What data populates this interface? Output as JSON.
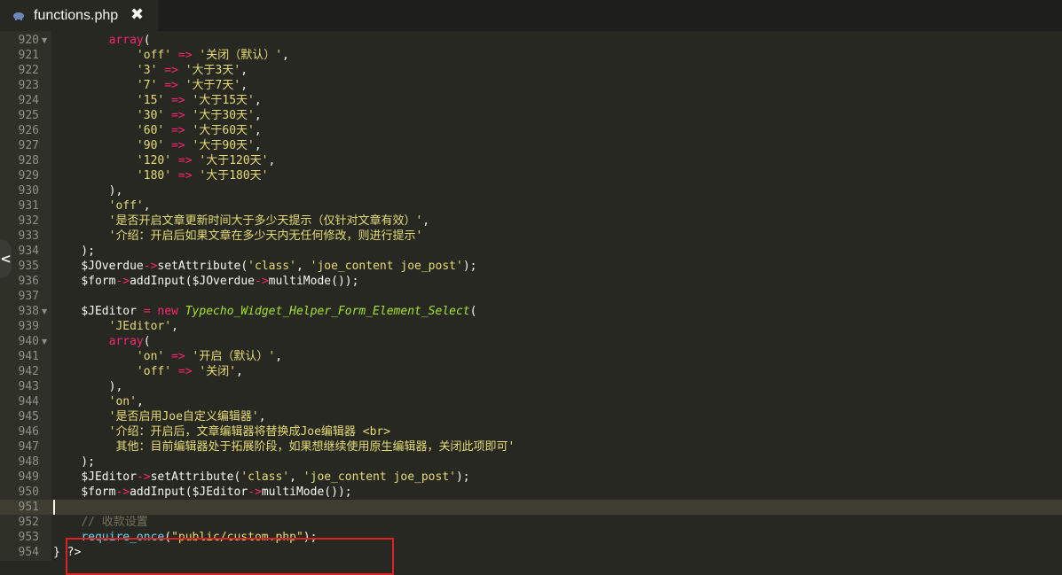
{
  "tab": {
    "filename": "functions.php",
    "close_glyph": "✖",
    "icon": "php-elephant-icon"
  },
  "side_toggle": {
    "glyph": "<"
  },
  "colors": {
    "background": "#272822",
    "gutter": "#2f3129",
    "string": "#e6db74",
    "keyword": "#f92672",
    "class": "#a6e22e",
    "comment": "#75715e",
    "highlight_box": "#e02020"
  },
  "lines": [
    {
      "n": "920",
      "fold": true,
      "tokens": [
        [
          "p",
          "        "
        ],
        [
          "k",
          "array"
        ],
        [
          "p",
          "("
        ]
      ]
    },
    {
      "n": "921",
      "fold": false,
      "tokens": [
        [
          "p",
          "            "
        ],
        [
          "s",
          "'off'"
        ],
        [
          "p",
          " "
        ],
        [
          "k",
          "=>"
        ],
        [
          "p",
          " "
        ],
        [
          "s",
          "'关闭（默认）'"
        ],
        [
          "p",
          ","
        ]
      ]
    },
    {
      "n": "922",
      "fold": false,
      "tokens": [
        [
          "p",
          "            "
        ],
        [
          "s",
          "'3'"
        ],
        [
          "p",
          " "
        ],
        [
          "k",
          "=>"
        ],
        [
          "p",
          " "
        ],
        [
          "s",
          "'大于3天'"
        ],
        [
          "p",
          ","
        ]
      ]
    },
    {
      "n": "923",
      "fold": false,
      "tokens": [
        [
          "p",
          "            "
        ],
        [
          "s",
          "'7'"
        ],
        [
          "p",
          " "
        ],
        [
          "k",
          "=>"
        ],
        [
          "p",
          " "
        ],
        [
          "s",
          "'大于7天'"
        ],
        [
          "p",
          ","
        ]
      ]
    },
    {
      "n": "924",
      "fold": false,
      "tokens": [
        [
          "p",
          "            "
        ],
        [
          "s",
          "'15'"
        ],
        [
          "p",
          " "
        ],
        [
          "k",
          "=>"
        ],
        [
          "p",
          " "
        ],
        [
          "s",
          "'大于15天'"
        ],
        [
          "p",
          ","
        ]
      ]
    },
    {
      "n": "925",
      "fold": false,
      "tokens": [
        [
          "p",
          "            "
        ],
        [
          "s",
          "'30'"
        ],
        [
          "p",
          " "
        ],
        [
          "k",
          "=>"
        ],
        [
          "p",
          " "
        ],
        [
          "s",
          "'大于30天'"
        ],
        [
          "p",
          ","
        ]
      ]
    },
    {
      "n": "926",
      "fold": false,
      "tokens": [
        [
          "p",
          "            "
        ],
        [
          "s",
          "'60'"
        ],
        [
          "p",
          " "
        ],
        [
          "k",
          "=>"
        ],
        [
          "p",
          " "
        ],
        [
          "s",
          "'大于60天'"
        ],
        [
          "p",
          ","
        ]
      ]
    },
    {
      "n": "927",
      "fold": false,
      "tokens": [
        [
          "p",
          "            "
        ],
        [
          "s",
          "'90'"
        ],
        [
          "p",
          " "
        ],
        [
          "k",
          "=>"
        ],
        [
          "p",
          " "
        ],
        [
          "s",
          "'大于90天'"
        ],
        [
          "p",
          ","
        ]
      ]
    },
    {
      "n": "928",
      "fold": false,
      "tokens": [
        [
          "p",
          "            "
        ],
        [
          "s",
          "'120'"
        ],
        [
          "p",
          " "
        ],
        [
          "k",
          "=>"
        ],
        [
          "p",
          " "
        ],
        [
          "s",
          "'大于120天'"
        ],
        [
          "p",
          ","
        ]
      ]
    },
    {
      "n": "929",
      "fold": false,
      "tokens": [
        [
          "p",
          "            "
        ],
        [
          "s",
          "'180'"
        ],
        [
          "p",
          " "
        ],
        [
          "k",
          "=>"
        ],
        [
          "p",
          " "
        ],
        [
          "s",
          "'大于180天'"
        ]
      ]
    },
    {
      "n": "930",
      "fold": false,
      "tokens": [
        [
          "p",
          "        ),"
        ]
      ]
    },
    {
      "n": "931",
      "fold": false,
      "tokens": [
        [
          "p",
          "        "
        ],
        [
          "s",
          "'off'"
        ],
        [
          "p",
          ","
        ]
      ]
    },
    {
      "n": "932",
      "fold": false,
      "tokens": [
        [
          "p",
          "        "
        ],
        [
          "s",
          "'是否开启文章更新时间大于多少天提示（仅针对文章有效）'"
        ],
        [
          "p",
          ","
        ]
      ]
    },
    {
      "n": "933",
      "fold": false,
      "tokens": [
        [
          "p",
          "        "
        ],
        [
          "s",
          "'介绍：开启后如果文章在多少天内无任何修改，则进行提示'"
        ]
      ]
    },
    {
      "n": "934",
      "fold": false,
      "tokens": [
        [
          "p",
          "    );"
        ]
      ]
    },
    {
      "n": "935",
      "fold": false,
      "tokens": [
        [
          "p",
          "    "
        ],
        [
          "v",
          "$JOverdue"
        ],
        [
          "k",
          "->"
        ],
        [
          "f",
          "setAttribute"
        ],
        [
          "p",
          "("
        ],
        [
          "s",
          "'class'"
        ],
        [
          "p",
          ", "
        ],
        [
          "s",
          "'joe_content joe_post'"
        ],
        [
          "p",
          ");"
        ]
      ]
    },
    {
      "n": "936",
      "fold": false,
      "tokens": [
        [
          "p",
          "    "
        ],
        [
          "v",
          "$form"
        ],
        [
          "k",
          "->"
        ],
        [
          "f",
          "addInput"
        ],
        [
          "p",
          "("
        ],
        [
          "v",
          "$JOverdue"
        ],
        [
          "k",
          "->"
        ],
        [
          "f",
          "multiMode"
        ],
        [
          "p",
          "());"
        ]
      ]
    },
    {
      "n": "937",
      "fold": false,
      "tokens": []
    },
    {
      "n": "938",
      "fold": true,
      "tokens": [
        [
          "p",
          "    "
        ],
        [
          "v",
          "$JEditor"
        ],
        [
          "p",
          " "
        ],
        [
          "k",
          "="
        ],
        [
          "p",
          " "
        ],
        [
          "k",
          "new"
        ],
        [
          "p",
          " "
        ],
        [
          "c",
          "Typecho_Widget_Helper_Form_Element_Select"
        ],
        [
          "p",
          "("
        ]
      ]
    },
    {
      "n": "939",
      "fold": false,
      "tokens": [
        [
          "p",
          "        "
        ],
        [
          "s",
          "'JEditor'"
        ],
        [
          "p",
          ","
        ]
      ]
    },
    {
      "n": "940",
      "fold": true,
      "tokens": [
        [
          "p",
          "        "
        ],
        [
          "k",
          "array"
        ],
        [
          "p",
          "("
        ]
      ]
    },
    {
      "n": "941",
      "fold": false,
      "tokens": [
        [
          "p",
          "            "
        ],
        [
          "s",
          "'on'"
        ],
        [
          "p",
          " "
        ],
        [
          "k",
          "=>"
        ],
        [
          "p",
          " "
        ],
        [
          "s",
          "'开启（默认）'"
        ],
        [
          "p",
          ","
        ]
      ]
    },
    {
      "n": "942",
      "fold": false,
      "tokens": [
        [
          "p",
          "            "
        ],
        [
          "s",
          "'off'"
        ],
        [
          "p",
          " "
        ],
        [
          "k",
          "=>"
        ],
        [
          "p",
          " "
        ],
        [
          "s",
          "'关闭'"
        ],
        [
          "p",
          ","
        ]
      ]
    },
    {
      "n": "943",
      "fold": false,
      "tokens": [
        [
          "p",
          "        ),"
        ]
      ]
    },
    {
      "n": "944",
      "fold": false,
      "tokens": [
        [
          "p",
          "        "
        ],
        [
          "s",
          "'on'"
        ],
        [
          "p",
          ","
        ]
      ]
    },
    {
      "n": "945",
      "fold": false,
      "tokens": [
        [
          "p",
          "        "
        ],
        [
          "s",
          "'是否启用Joe自定义编辑器'"
        ],
        [
          "p",
          ","
        ]
      ]
    },
    {
      "n": "946",
      "fold": false,
      "tokens": [
        [
          "p",
          "        "
        ],
        [
          "s",
          "'介绍：开启后，文章编辑器将替换成Joe编辑器 <br>"
        ]
      ]
    },
    {
      "n": "947",
      "fold": false,
      "tokens": [
        [
          "p",
          "         "
        ],
        [
          "s",
          "其他：目前编辑器处于拓展阶段，如果想继续使用原生编辑器，关闭此项即可'"
        ]
      ]
    },
    {
      "n": "948",
      "fold": false,
      "tokens": [
        [
          "p",
          "    );"
        ]
      ]
    },
    {
      "n": "949",
      "fold": false,
      "tokens": [
        [
          "p",
          "    "
        ],
        [
          "v",
          "$JEditor"
        ],
        [
          "k",
          "->"
        ],
        [
          "f",
          "setAttribute"
        ],
        [
          "p",
          "("
        ],
        [
          "s",
          "'class'"
        ],
        [
          "p",
          ", "
        ],
        [
          "s",
          "'joe_content joe_post'"
        ],
        [
          "p",
          ");"
        ]
      ]
    },
    {
      "n": "950",
      "fold": false,
      "tokens": [
        [
          "p",
          "    "
        ],
        [
          "v",
          "$form"
        ],
        [
          "k",
          "->"
        ],
        [
          "f",
          "addInput"
        ],
        [
          "p",
          "("
        ],
        [
          "v",
          "$JEditor"
        ],
        [
          "k",
          "->"
        ],
        [
          "f",
          "multiMode"
        ],
        [
          "p",
          "());"
        ]
      ]
    },
    {
      "n": "951",
      "fold": false,
      "active": true,
      "tokens": []
    },
    {
      "n": "952",
      "fold": false,
      "tokens": [
        [
          "p",
          "    "
        ],
        [
          "cm",
          "// 收款设置"
        ]
      ]
    },
    {
      "n": "953",
      "fold": false,
      "tokens": [
        [
          "p",
          "    "
        ],
        [
          "fn",
          "require_once"
        ],
        [
          "p",
          "("
        ],
        [
          "s",
          "\"public/custom.php\""
        ],
        [
          "p",
          ");"
        ]
      ]
    },
    {
      "n": "954",
      "fold": false,
      "tokens": [
        [
          "p",
          "} ?>"
        ]
      ]
    }
  ]
}
